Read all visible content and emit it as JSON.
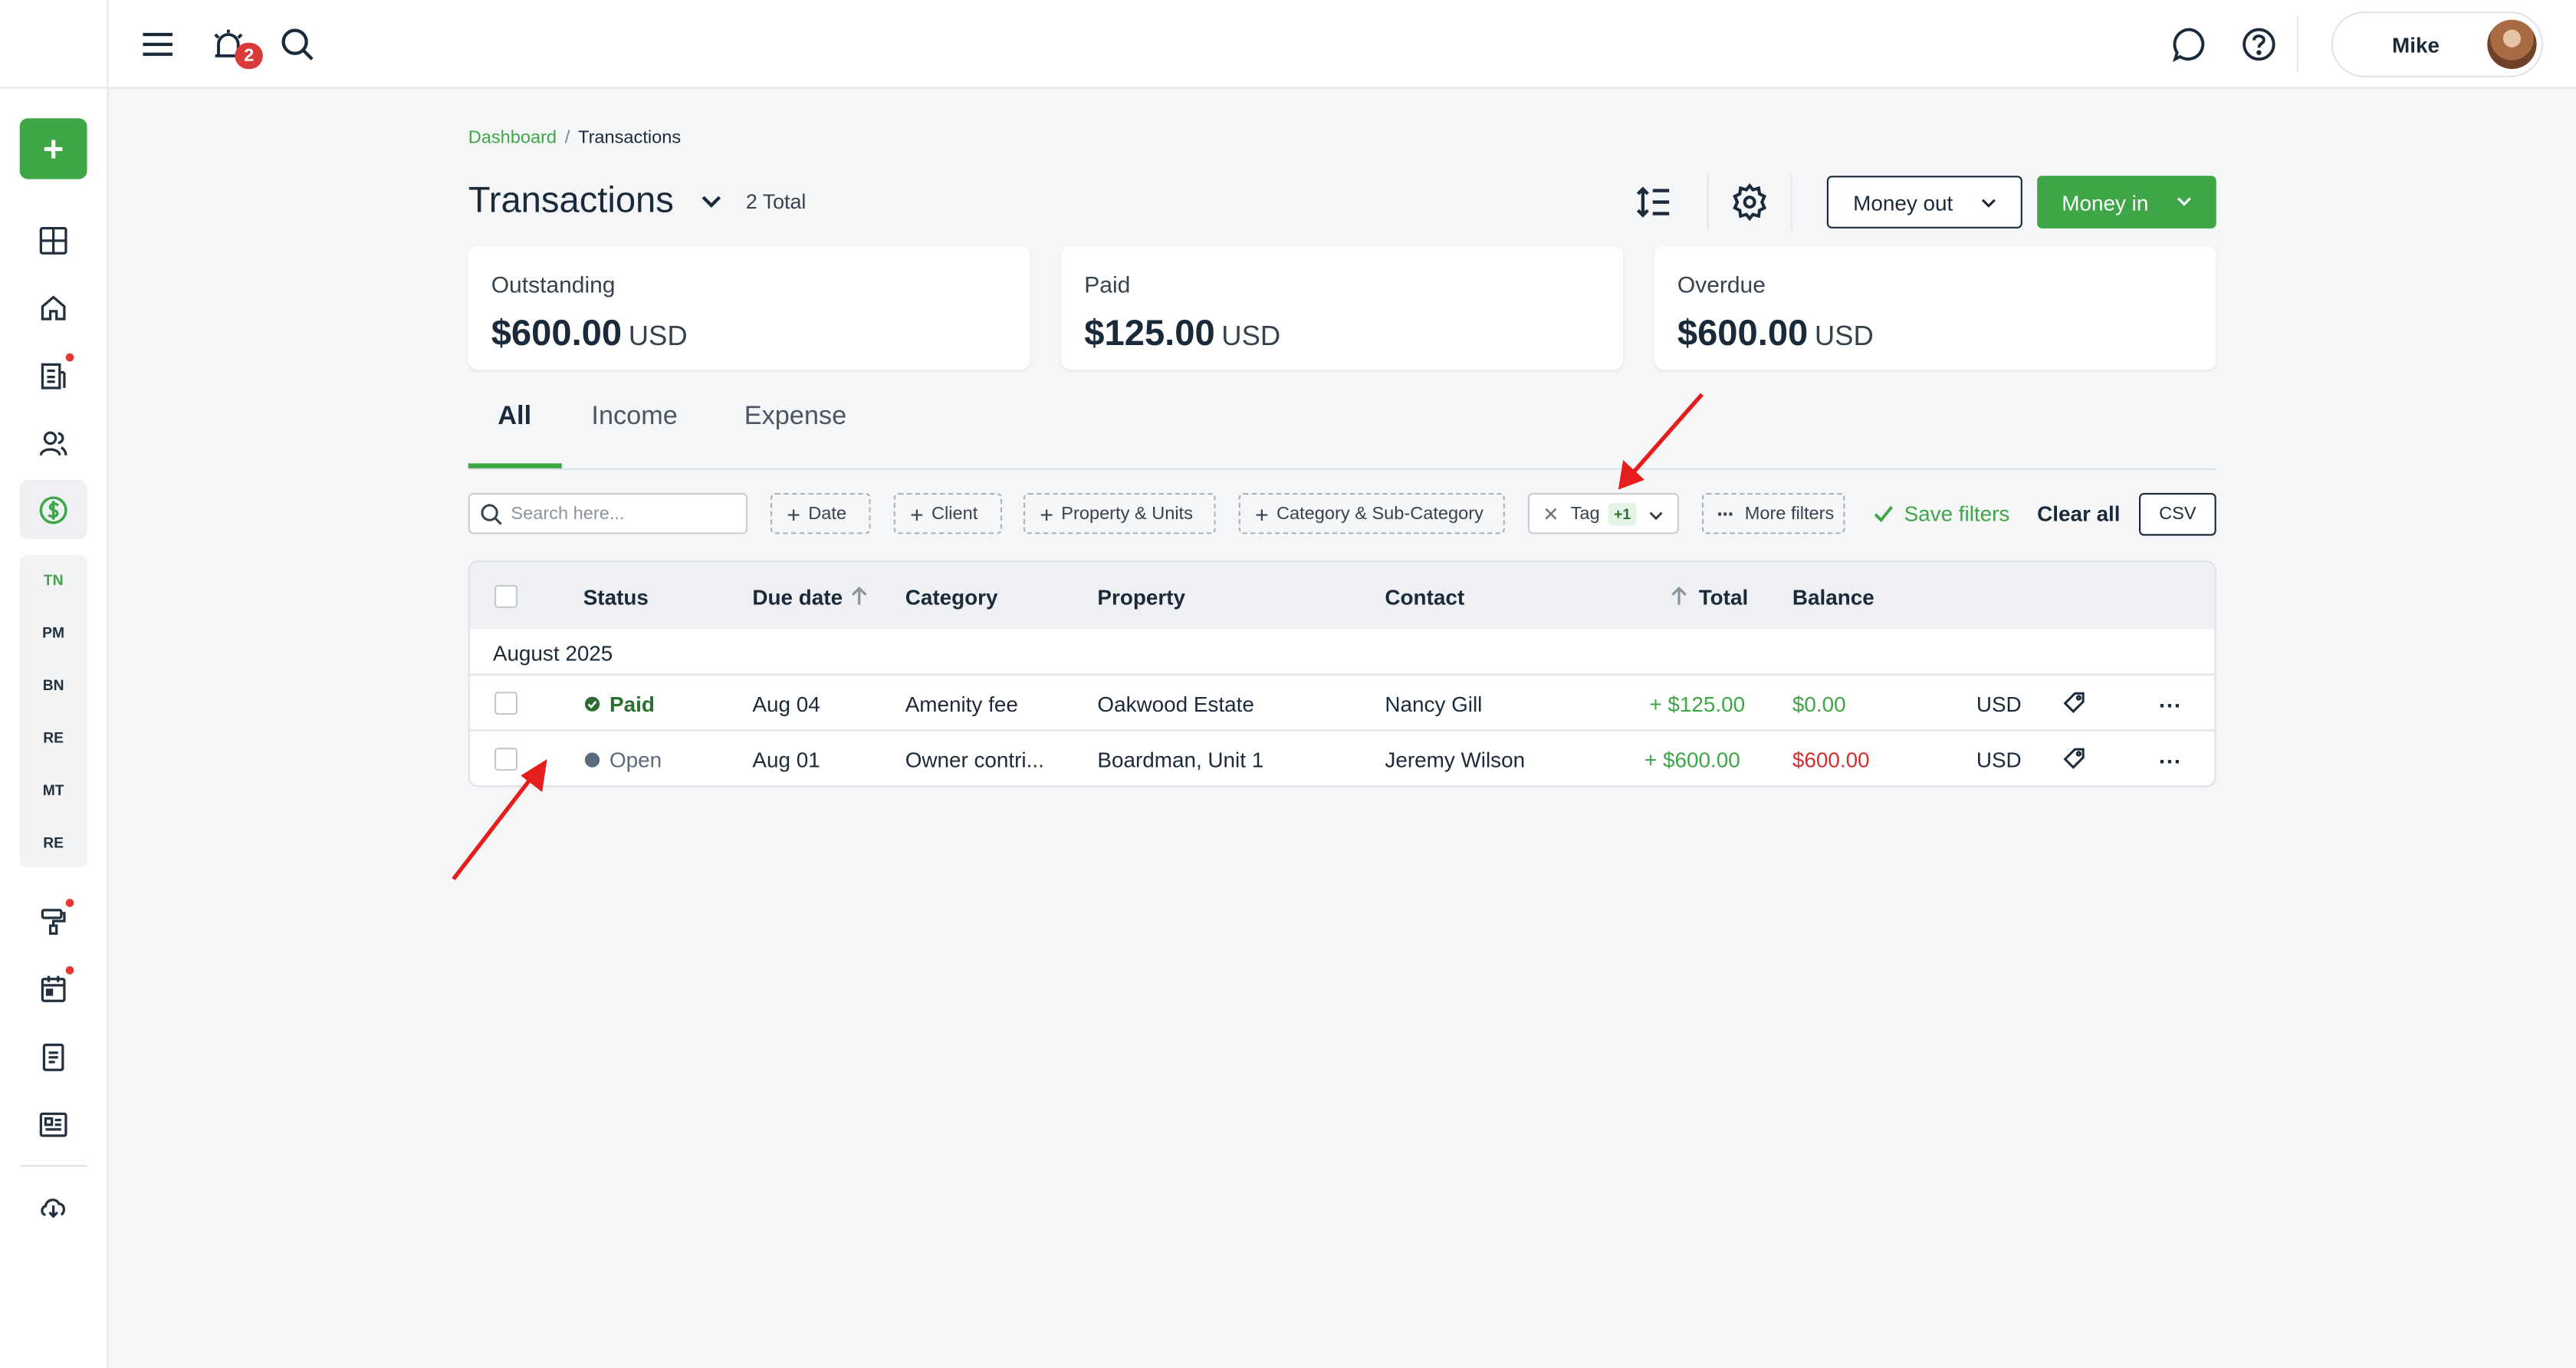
{
  "topbar": {
    "notification_count": "2",
    "user_name": "Mike"
  },
  "sidebar": {
    "add_label": "+",
    "sub_items": [
      "TN",
      "PM",
      "BN",
      "RE",
      "MT",
      "RE"
    ]
  },
  "breadcrumb": {
    "root": "Dashboard",
    "separator": "/",
    "current": "Transactions"
  },
  "header": {
    "title": "Transactions",
    "total": "2 Total",
    "money_out": "Money out",
    "money_in": "Money in"
  },
  "summary": [
    {
      "label": "Outstanding",
      "amount": "$600.00",
      "currency": "USD"
    },
    {
      "label": "Paid",
      "amount": "$125.00",
      "currency": "USD"
    },
    {
      "label": "Overdue",
      "amount": "$600.00",
      "currency": "USD"
    }
  ],
  "tabs": [
    "All",
    "Income",
    "Expense"
  ],
  "filters": {
    "search_placeholder": "Search here...",
    "chips": [
      "Date",
      "Client",
      "Property & Units",
      "Category & Sub-Category"
    ],
    "tag_label": "Tag",
    "tag_count": "+1",
    "more_filters": "More filters",
    "save_filters": "Save filters",
    "clear_all": "Clear all",
    "csv": "CSV"
  },
  "table": {
    "columns": {
      "status": "Status",
      "due_date": "Due date",
      "category": "Category",
      "property": "Property",
      "contact": "Contact",
      "total": "Total",
      "balance": "Balance"
    },
    "group": "August 2025",
    "rows": [
      {
        "status": "Paid",
        "due": "Aug 04",
        "category": "Amenity fee",
        "property": "Oakwood Estate",
        "contact": "Nancy Gill",
        "total": "+ $125.00",
        "balance": "$0.00",
        "currency": "USD"
      },
      {
        "status": "Open",
        "due": "Aug 01",
        "category": "Owner contri...",
        "property": "Boardman, Unit 1",
        "contact": "Jeremy Wilson",
        "total": "+ $600.00",
        "balance": "$600.00",
        "currency": "USD"
      }
    ]
  },
  "colors": {
    "accent": "#3ea646",
    "danger": "#d32f2f",
    "annotation_arrow": "#e51d1d"
  }
}
